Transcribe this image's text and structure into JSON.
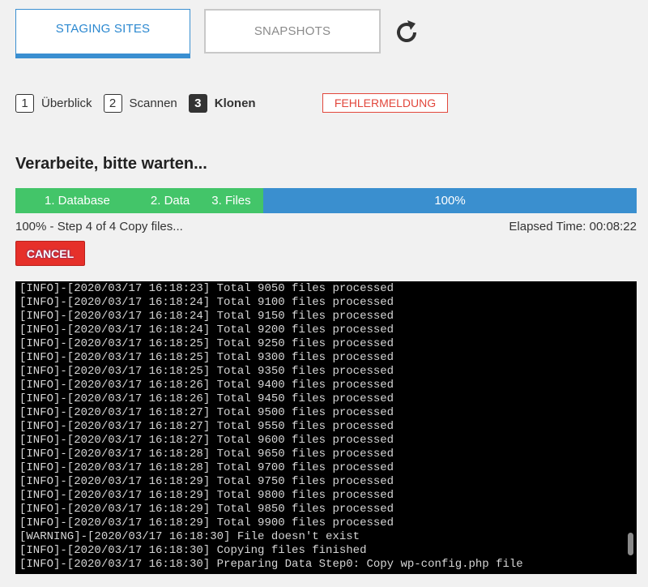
{
  "tabs": {
    "staging": "STAGING SITES",
    "snapshots": "SNAPSHOTS"
  },
  "steps": [
    {
      "num": "1",
      "label": "Überblick"
    },
    {
      "num": "2",
      "label": "Scannen"
    },
    {
      "num": "3",
      "label": "Klonen"
    }
  ],
  "error_button": "FEHLERMELDUNG",
  "heading": "Verarbeite, bitte warten...",
  "progress": {
    "step1": "1. Database",
    "step2": "2. Data",
    "step3": "3. Files",
    "percent": "100%",
    "value": 1.0
  },
  "status": {
    "text": "100% - Step 4 of 4 Copy files...",
    "elapsed": "Elapsed Time: 00:08:22"
  },
  "cancel_button": "CANCEL",
  "log": [
    "[INFO]-[2020/03/17 16:18:23] Total 9050 files processed",
    "[INFO]-[2020/03/17 16:18:24] Total 9100 files processed",
    "[INFO]-[2020/03/17 16:18:24] Total 9150 files processed",
    "[INFO]-[2020/03/17 16:18:24] Total 9200 files processed",
    "[INFO]-[2020/03/17 16:18:25] Total 9250 files processed",
    "[INFO]-[2020/03/17 16:18:25] Total 9300 files processed",
    "[INFO]-[2020/03/17 16:18:25] Total 9350 files processed",
    "[INFO]-[2020/03/17 16:18:26] Total 9400 files processed",
    "[INFO]-[2020/03/17 16:18:26] Total 9450 files processed",
    "[INFO]-[2020/03/17 16:18:27] Total 9500 files processed",
    "[INFO]-[2020/03/17 16:18:27] Total 9550 files processed",
    "[INFO]-[2020/03/17 16:18:27] Total 9600 files processed",
    "[INFO]-[2020/03/17 16:18:28] Total 9650 files processed",
    "[INFO]-[2020/03/17 16:18:28] Total 9700 files processed",
    "[INFO]-[2020/03/17 16:18:29] Total 9750 files processed",
    "[INFO]-[2020/03/17 16:18:29] Total 9800 files processed",
    "[INFO]-[2020/03/17 16:18:29] Total 9850 files processed",
    "[INFO]-[2020/03/17 16:18:29] Total 9900 files processed",
    "[WARNING]-[2020/03/17 16:18:30] File doesn't exist",
    "[INFO]-[2020/03/17 16:18:30] Copying files finished",
    "[INFO]-[2020/03/17 16:18:30] Preparing Data Step0: Copy wp-config.php file"
  ],
  "colors": {
    "accent": "#3a8fd1",
    "progress_done": "#43c569",
    "progress_bar": "#3a8fcf",
    "danger": "#e6302a",
    "log_bg": "#000000"
  }
}
